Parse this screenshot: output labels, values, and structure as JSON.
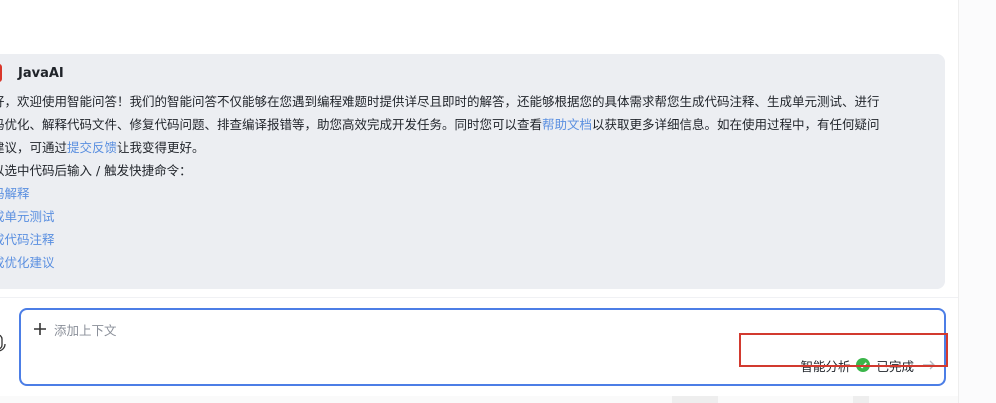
{
  "message": {
    "avatar_char": "算",
    "sender": "JavaAI",
    "line1": "好，欢迎使用智能问答！我们的智能问答不仅能够在您遇到编程难题时提供详尽且即时的解答，还能够根据您的具体需求帮您生成代码注释、生成单元测试、进行",
    "line2": "码优化、解释代码文件、修复代码问题、排查编译报错等，助您高效完成开发任务。同时您可以查看",
    "line2_link": "帮助文档",
    "line2_after": "以获取更多详细信息。如在使用过程中，有任何疑问",
    "line3_before": "建议，可通过",
    "line3_link": "提交反馈",
    "line3_after": "让我变得更好。",
    "line4": "以选中代码后输入 / 触发快捷命令：",
    "commands": [
      "码解释",
      "成单元测试",
      "成代码注释",
      "成优化建议"
    ]
  },
  "input": {
    "add_context_label": "添加上下文",
    "mode_label": "智能分析",
    "status_label": "已完成"
  },
  "colors": {
    "accent": "#4c7ee6",
    "link": "#5a8fe0",
    "success": "#3bb54a",
    "highlight": "#d23a2f",
    "bubble": "#eceef2"
  }
}
